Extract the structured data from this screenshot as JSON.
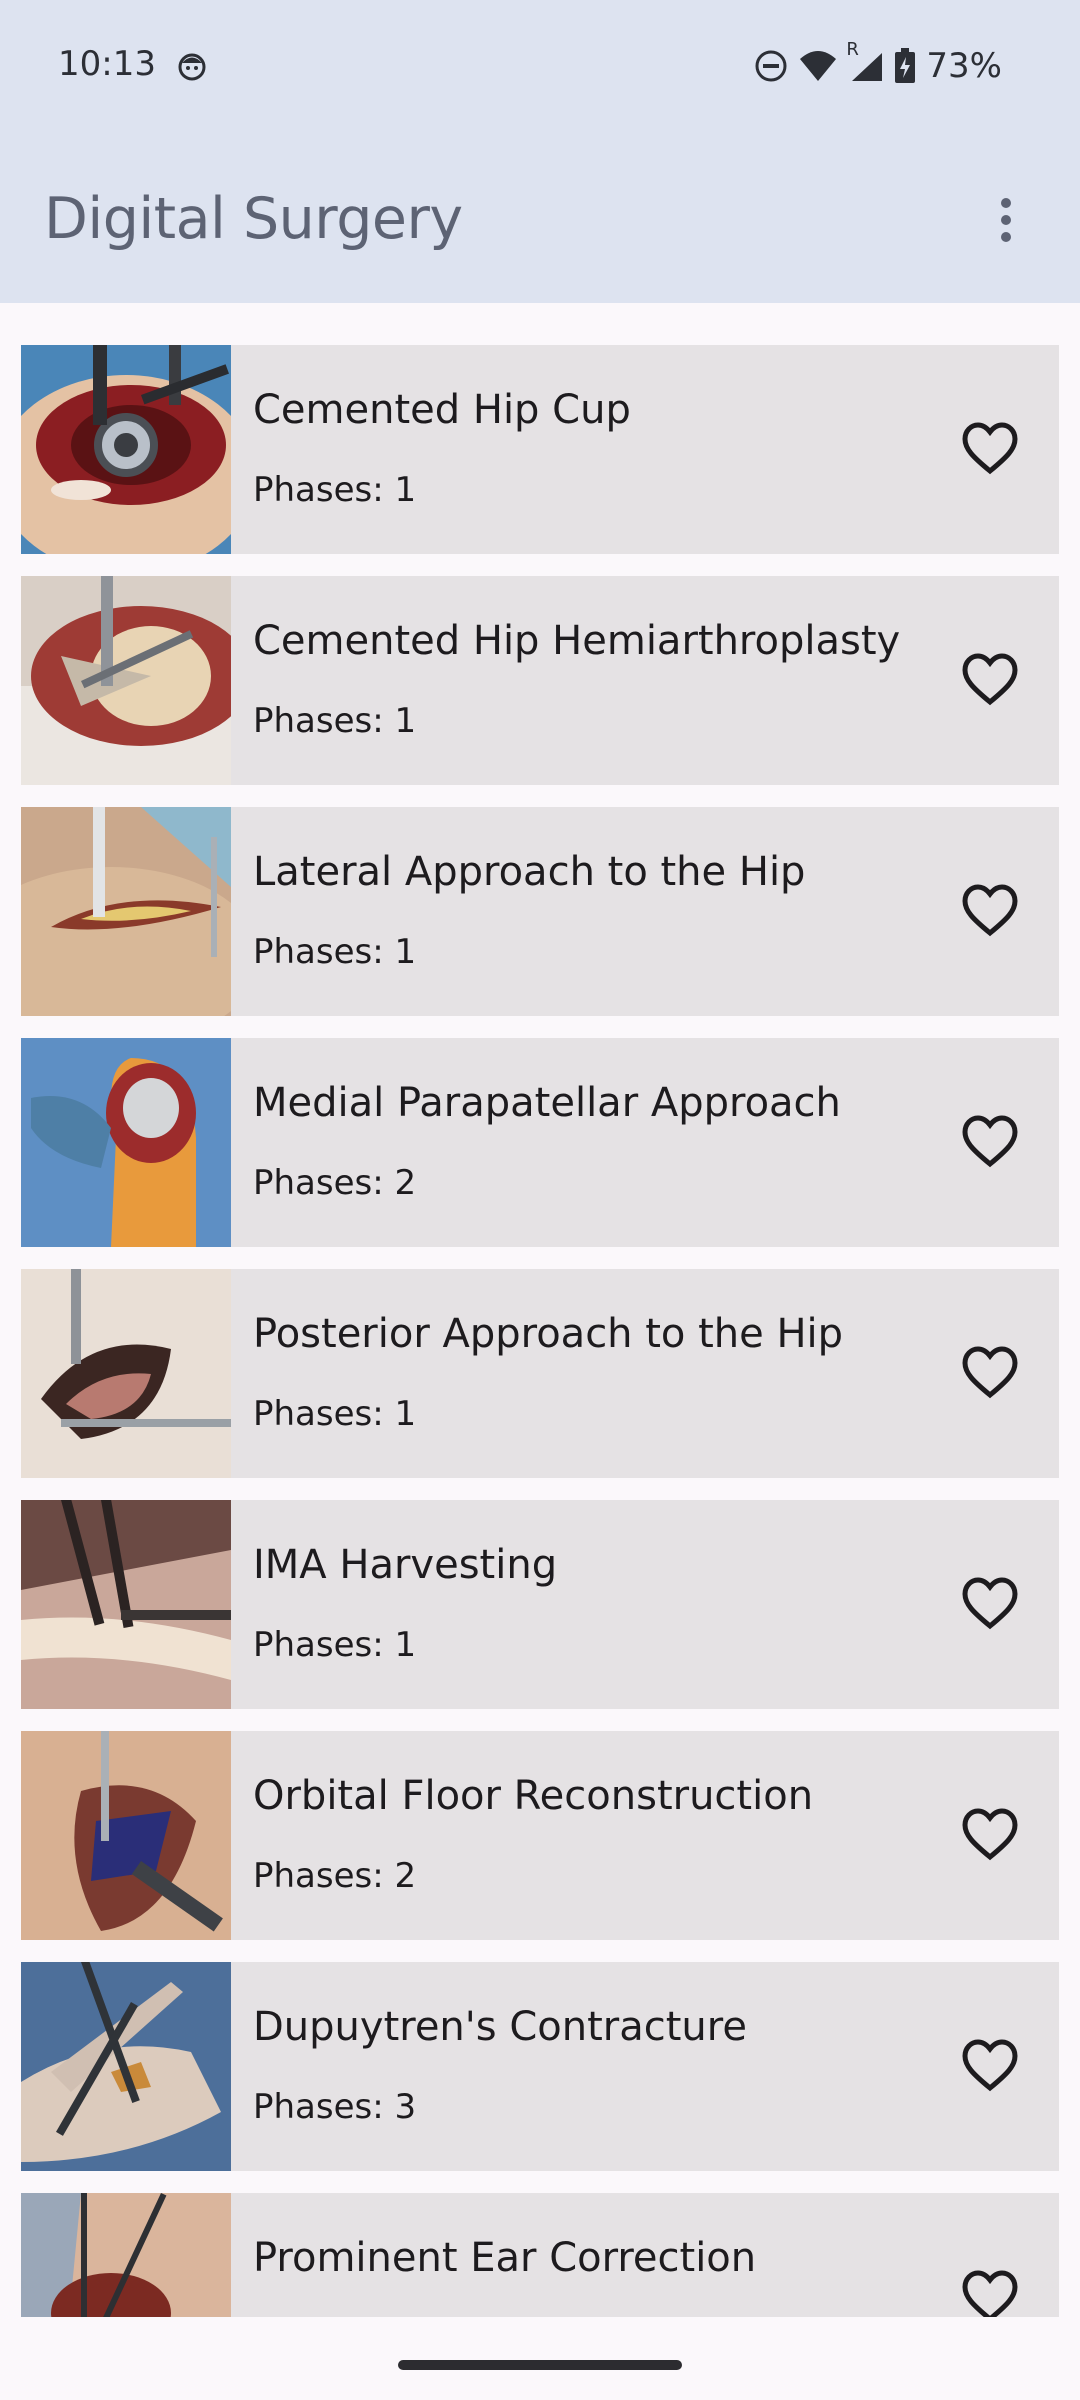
{
  "status_bar": {
    "time": "10:13",
    "battery": "73%",
    "network_indicator": "R",
    "icons": [
      "face-icon",
      "dnd-icon",
      "wifi-icon",
      "signal-icon",
      "battery-icon"
    ]
  },
  "app_bar": {
    "title": "Digital Surgery",
    "overflow_icon": "more-vert-icon"
  },
  "colors": {
    "app_bar_bg": "#dde3f0",
    "page_bg": "#fbf8fb",
    "card_bg": "#e5e2e4",
    "text": "#1d1b1e",
    "title_text": "#5d6374"
  },
  "procedures": [
    {
      "title": "Cemented Hip Cup",
      "phases": "Phases: 1",
      "favorite_icon": "heart-outline-icon"
    },
    {
      "title": "Cemented Hip Hemiarthroplasty",
      "phases": "Phases: 1",
      "favorite_icon": "heart-outline-icon"
    },
    {
      "title": "Lateral Approach to the Hip",
      "phases": "Phases: 1",
      "favorite_icon": "heart-outline-icon"
    },
    {
      "title": "Medial Parapatellar Approach",
      "phases": "Phases: 2",
      "favorite_icon": "heart-outline-icon"
    },
    {
      "title": "Posterior Approach to the Hip",
      "phases": "Phases: 1",
      "favorite_icon": "heart-outline-icon"
    },
    {
      "title": "IMA Harvesting",
      "phases": "Phases: 1",
      "favorite_icon": "heart-outline-icon"
    },
    {
      "title": "Orbital Floor Reconstruction",
      "phases": "Phases: 2",
      "favorite_icon": "heart-outline-icon"
    },
    {
      "title": "Dupuytren's Contracture",
      "phases": "Phases: 3",
      "favorite_icon": "heart-outline-icon"
    },
    {
      "title": "Prominent Ear Correction",
      "phases": "",
      "favorite_icon": "heart-outline-icon"
    }
  ]
}
